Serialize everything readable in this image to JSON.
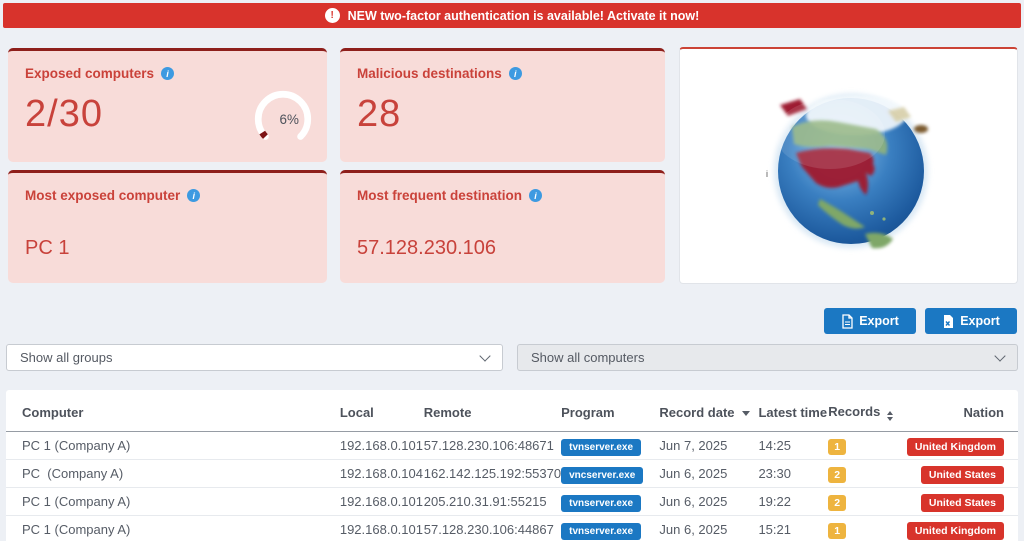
{
  "banner": {
    "icon_glyph": "!",
    "text": "NEW two-factor authentication is available! Activate it now!"
  },
  "icons": {
    "info_glyph": "i"
  },
  "cards": {
    "exposed_computers": {
      "title": "Exposed computers",
      "value": "2/30",
      "gauge_percent": "6%"
    },
    "malicious_destinations": {
      "title": "Malicious destinations",
      "value": "28"
    },
    "most_exposed_computer": {
      "title": "Most exposed computer",
      "value": "PC 1"
    },
    "most_frequent_destination": {
      "title": "Most frequent destination",
      "value": "57.128.230.106"
    }
  },
  "globe": {
    "marker": "i",
    "highlighted_country": "United States"
  },
  "toolbar": {
    "export_pdf_label": "Export",
    "export_excel_label": "Export"
  },
  "filters": {
    "groups_value": "Show all groups",
    "computers_value": "Show all computers"
  },
  "table": {
    "headers": [
      "Computer",
      "Local",
      "Remote",
      "Program",
      "Record date",
      "Latest time",
      "Records",
      "Nation"
    ],
    "rows": [
      {
        "computer": "PC 1 (Company A)",
        "local": "192.168.0.101",
        "remote": "57.128.230.106:48671",
        "program": "tvnserver.exe",
        "record_date": "Jun 7, 2025",
        "latest_time": "14:25",
        "records": "1",
        "nation": "United Kingdom"
      },
      {
        "computer": "PC  (Company A)",
        "local": "192.168.0.104",
        "remote": "162.142.125.192:55370",
        "program": "vncserver.exe",
        "record_date": "Jun 6, 2025",
        "latest_time": "23:30",
        "records": "2",
        "nation": "United States"
      },
      {
        "computer": "PC 1 (Company A)",
        "local": "192.168.0.101",
        "remote": "205.210.31.91:55215",
        "program": "tvnserver.exe",
        "record_date": "Jun 6, 2025",
        "latest_time": "19:22",
        "records": "2",
        "nation": "United States"
      },
      {
        "computer": "PC 1 (Company A)",
        "local": "192.168.0.101",
        "remote": "57.128.230.106:44867",
        "program": "tvnserver.exe",
        "record_date": "Jun 6, 2025",
        "latest_time": "15:21",
        "records": "1",
        "nation": "United Kingdom"
      }
    ]
  },
  "colors": {
    "banner_red": "#d8332c",
    "card_pink": "#f8dcd9",
    "card_border_red": "#8e1f1b",
    "title_red": "#ca423a",
    "value_red": "#c8423b",
    "accent_blue": "#1b78c3",
    "badge_amber": "#eeb43f",
    "badge_red": "#d8342b",
    "info_blue": "#3d9ae1",
    "gauge_fill_red": "#7d1416"
  }
}
